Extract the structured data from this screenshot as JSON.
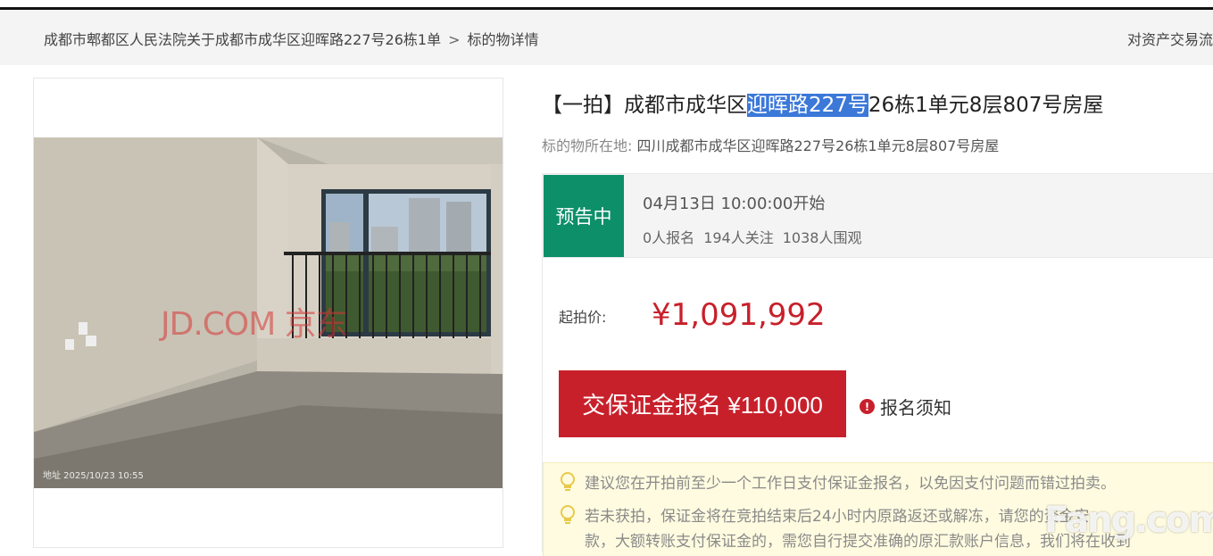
{
  "breadcrumb": {
    "item1": "成都市郫都区人民法院关于成都市成华区迎晖路227号26栋1单",
    "separator": ">",
    "item2": "标的物详情",
    "right_text": "对资产交易流"
  },
  "photo": {
    "watermark": "JD.COM 京东",
    "timestamp": "地址   2025/10/23 10:55"
  },
  "listing": {
    "title_prefix": "【一拍】成都市成华区",
    "title_highlight": "迎晖路227号",
    "title_suffix": "26栋1单元8层807号房屋",
    "location_label": "标的物所在地:",
    "location_value": "四川成都市成华区迎晖路227号26栋1单元8层807号房屋"
  },
  "status": {
    "badge": "预告中",
    "start_time": "04月13日 10:00:00开始",
    "signups": "0人报名",
    "followers": "194人关注",
    "viewers": "1038人围观"
  },
  "price": {
    "label": "起拍价:",
    "value": "¥1,091,992"
  },
  "actions": {
    "signup_button": "交保证金报名 ¥110,000",
    "notice_link": "报名须知"
  },
  "tips": {
    "tip1": "建议您在开拍前至少一个工作日支付保证金报名，以免因支付问题而错过拍卖。",
    "tip2_line1": "若未获拍，保证金将在竞拍结束后24小时内原路返还或解冻，请您的资金安",
    "tip2_line2": "款，大额转账支付保证金的，需您自行提交准确的原汇款账户信息，我们将在收到"
  },
  "watermark_logo": "Fang.com",
  "colors": {
    "accent_red": "#c8202b",
    "status_green": "#0d8f6a",
    "highlight_blue": "#3b78d8",
    "tips_bg": "#fffbe0"
  }
}
